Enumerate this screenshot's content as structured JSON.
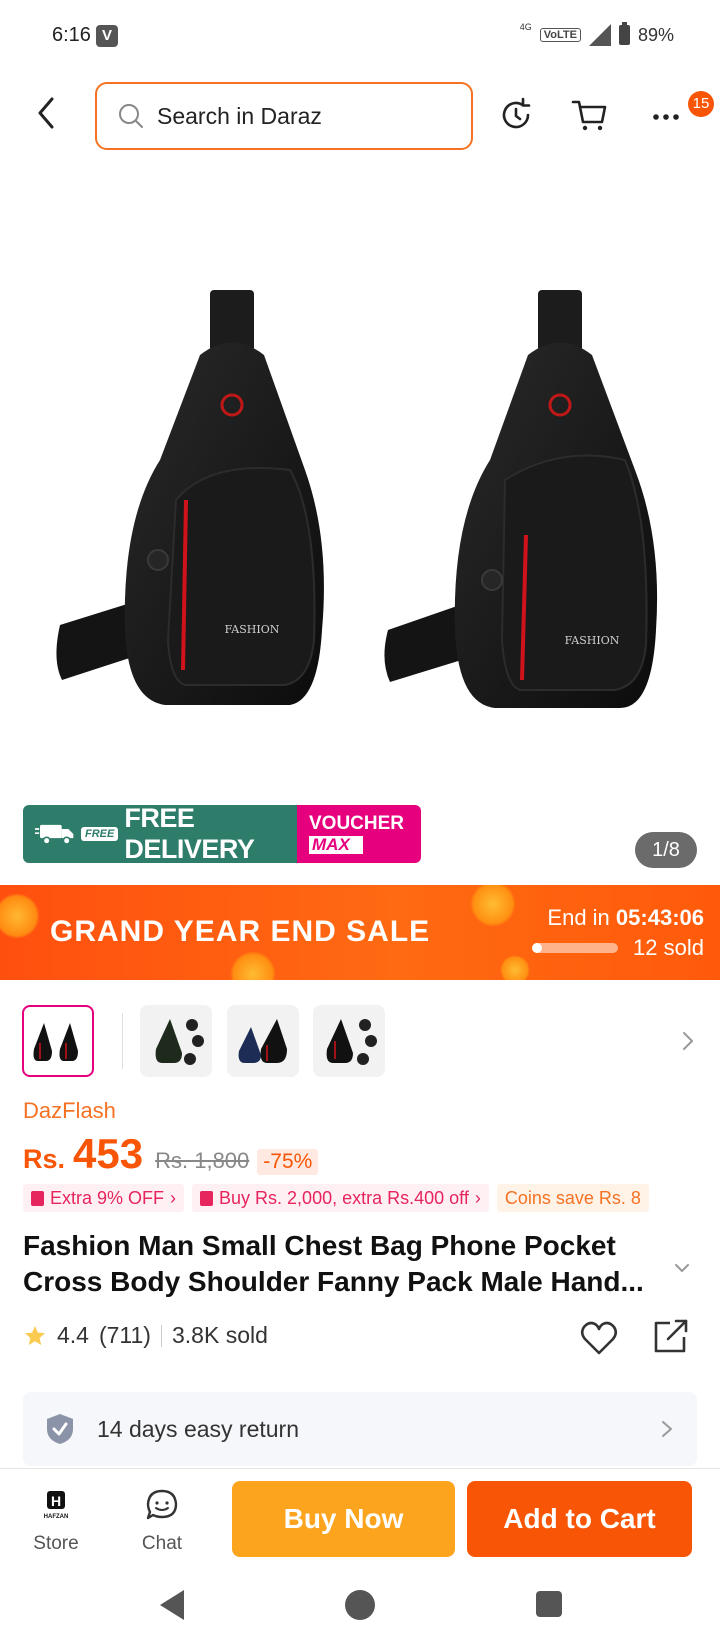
{
  "status_bar": {
    "time": "6:16",
    "network": "4G",
    "volte": "VoLTE",
    "battery": "89%"
  },
  "header": {
    "search_placeholder": "Search in Daraz",
    "cart_badge": "15"
  },
  "hero": {
    "pager": "1/8",
    "bag_label": "FASHION"
  },
  "promo": {
    "free_tag": "FREE",
    "free_delivery": "FREE DELIVERY",
    "voucher": "VOUCHER",
    "voucher_max": "MAX"
  },
  "sale": {
    "title": "GRAND YEAR END SALE",
    "end_in_label": "End in",
    "countdown": "05:43:06",
    "sold": "12 sold",
    "sold_progress": 0.12
  },
  "thumbnails": {
    "count": 4
  },
  "product": {
    "seller": "DazFlash",
    "currency": "Rs.",
    "price": "453",
    "original_price": "Rs. 1,800",
    "discount": "-75%",
    "offers": [
      "Extra 9% OFF",
      "Buy Rs. 2,000, extra Rs.400 off",
      "Coins save Rs. 8"
    ],
    "title": "Fashion Man Small Chest Bag Phone Pocket Cross Body Shoulder Fanny Pack Male Hand...",
    "rating": "4.4",
    "reviews": "(711)",
    "sold": "3.8K sold"
  },
  "return_policy": {
    "label": "14 days easy return"
  },
  "bottom": {
    "store_label": "Store",
    "store_logo_text": "HAFZAN",
    "chat_label": "Chat",
    "buy_now": "Buy Now",
    "add_to_cart": "Add to Cart"
  },
  "colors": {
    "accent": "#f85606",
    "search_border": "#f57224",
    "buy_now": "#fca41e",
    "delivery_green": "#2e7d6a",
    "voucher_pink": "#e6007e"
  }
}
